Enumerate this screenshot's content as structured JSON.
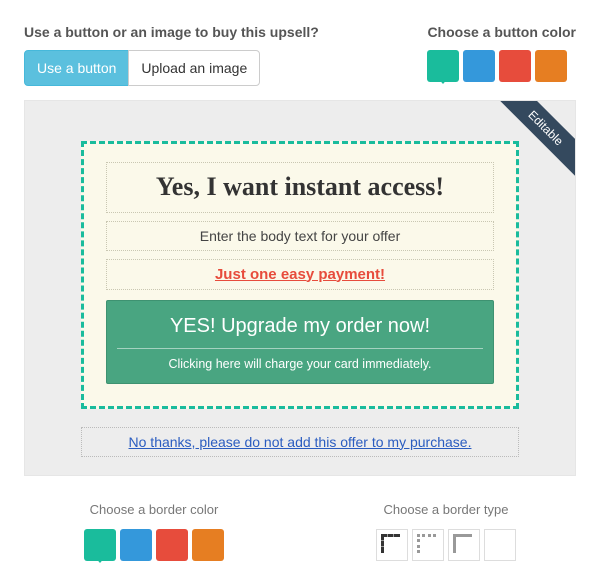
{
  "top": {
    "button_or_image_label": "Use a button or an image to buy this upsell?",
    "use_button": "Use a button",
    "upload_image": "Upload an image",
    "choose_color_label": "Choose a button color"
  },
  "ribbon": "Editable",
  "offer": {
    "title": "Yes, I want instant access!",
    "body": "Enter the body text for your offer",
    "price": "Just one easy payment!",
    "cta_main": "YES! Upgrade my order now!",
    "cta_sub": "Clicking here will charge your card immediately.",
    "decline": "No thanks, please do not add this offer to my purchase."
  },
  "bottom": {
    "border_color_label": "Choose a border color",
    "border_type_label": "Choose a border type"
  },
  "colors": {
    "green": "#1abc9c",
    "blue": "#3498db",
    "red": "#e74c3c",
    "orange": "#e67e22"
  }
}
